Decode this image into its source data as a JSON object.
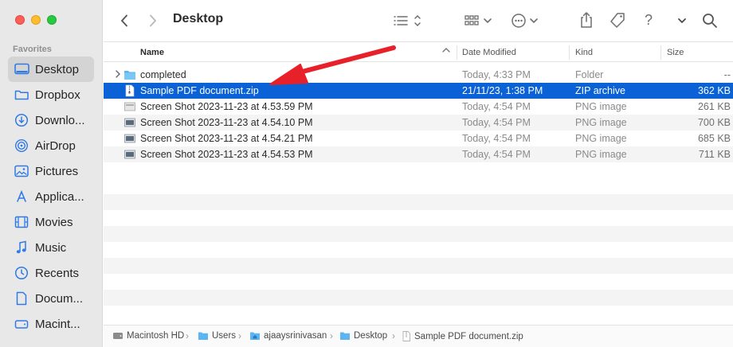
{
  "window": {
    "title": "Desktop"
  },
  "sidebar": {
    "heading": "Favorites",
    "items": [
      {
        "label": "Desktop",
        "icon": "desktop-icon",
        "active": true
      },
      {
        "label": "Dropbox",
        "icon": "folder-icon"
      },
      {
        "label": "Downlo...",
        "icon": "downloads-icon"
      },
      {
        "label": "AirDrop",
        "icon": "airdrop-icon"
      },
      {
        "label": "Pictures",
        "icon": "pictures-icon"
      },
      {
        "label": "Applica...",
        "icon": "applications-icon"
      },
      {
        "label": "Movies",
        "icon": "movies-icon"
      },
      {
        "label": "Music",
        "icon": "music-icon"
      },
      {
        "label": "Recents",
        "icon": "recents-icon"
      },
      {
        "label": "Docum...",
        "icon": "documents-icon"
      },
      {
        "label": "Macint...",
        "icon": "drive-icon"
      }
    ]
  },
  "columns": {
    "name": "Name",
    "date": "Date Modified",
    "kind": "Kind",
    "size": "Size"
  },
  "files": [
    {
      "name": "completed",
      "date": "Today, 4:33 PM",
      "kind": "Folder",
      "size": "--",
      "icon": "folder-icon"
    },
    {
      "name": "Sample PDF document.zip",
      "date": "21/11/23, 1:38 PM",
      "kind": "ZIP archive",
      "size": "362 KB",
      "icon": "zip-file-icon",
      "selected": true
    },
    {
      "name": "Screen Shot 2023-11-23 at 4.53.59 PM",
      "date": "Today, 4:54 PM",
      "kind": "PNG image",
      "size": "261 KB",
      "icon": "image-file-icon"
    },
    {
      "name": "Screen Shot 2023-11-23 at 4.54.10 PM",
      "date": "Today, 4:54 PM",
      "kind": "PNG image",
      "size": "700 KB",
      "icon": "image-file-icon"
    },
    {
      "name": "Screen Shot 2023-11-23 at 4.54.21 PM",
      "date": "Today, 4:54 PM",
      "kind": "PNG image",
      "size": "685 KB",
      "icon": "image-file-icon"
    },
    {
      "name": "Screen Shot 2023-11-23 at 4.54.53 PM",
      "date": "Today, 4:54 PM",
      "kind": "PNG image",
      "size": "711 KB",
      "icon": "image-file-icon"
    }
  ],
  "pathbar": [
    "Macintosh HD",
    "Users",
    "ajaaysrinivasan",
    "Desktop",
    "Sample PDF document.zip"
  ],
  "colors": {
    "selection": "#0a62d6",
    "annotation_arrow": "#e8202a",
    "folder": "#5ab5f0"
  }
}
